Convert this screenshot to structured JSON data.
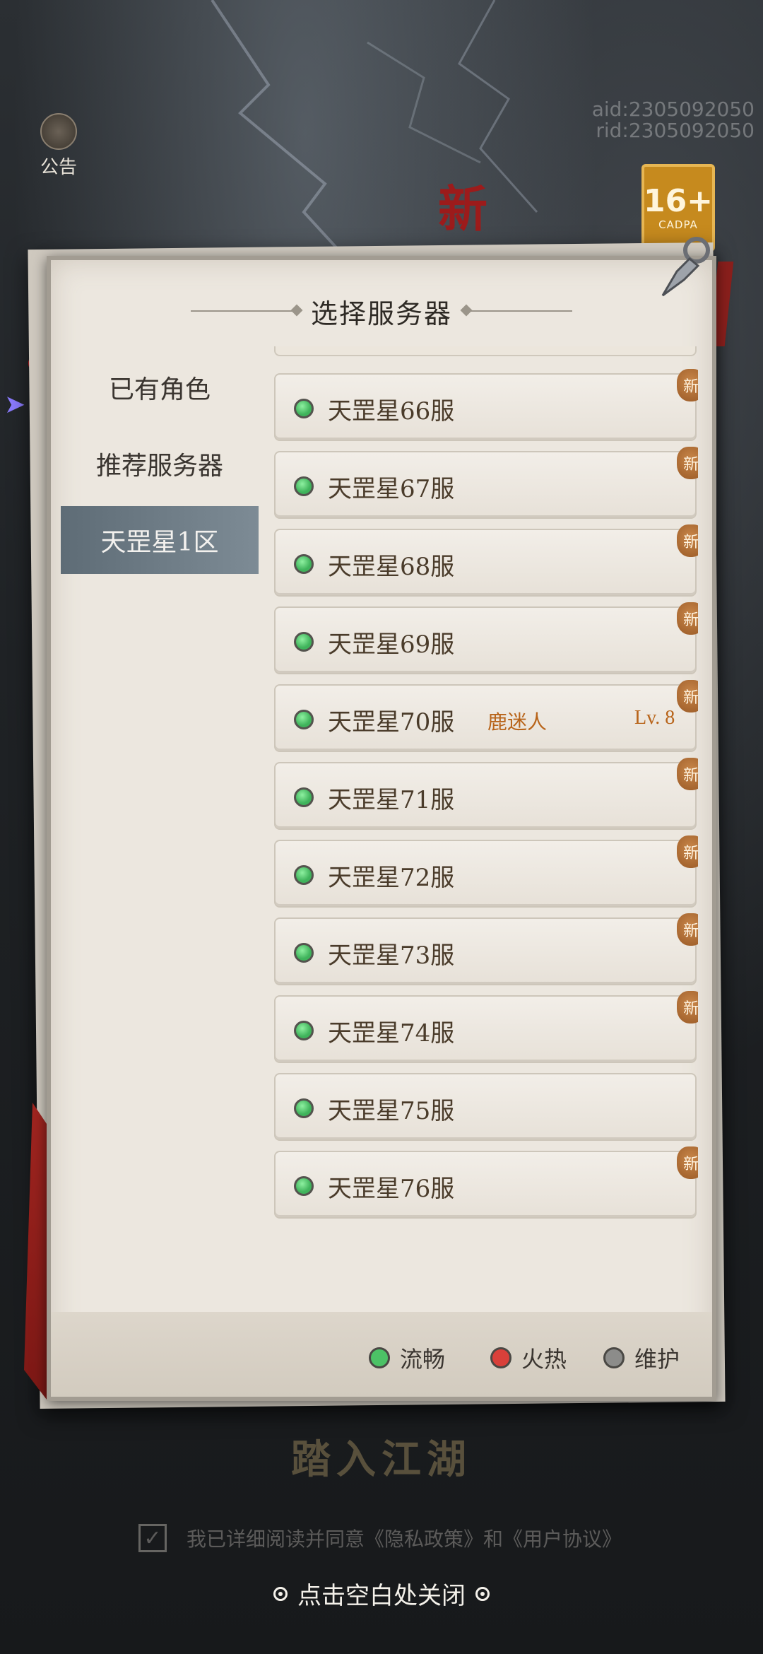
{
  "background": {
    "notice_label": "公告",
    "uid_lines": [
      "aid:2305092050",
      "rid:2305092050"
    ],
    "age_rating": {
      "main": "16+",
      "sub": "CADPA"
    },
    "seal_char": "新"
  },
  "dialog": {
    "title": "选择服务器",
    "sidebar": [
      {
        "label": "已有角色",
        "active": false
      },
      {
        "label": "推荐服务器",
        "active": false
      },
      {
        "label": "天罡星1区",
        "active": true
      }
    ],
    "servers": [
      {
        "name": "天罡星66服",
        "status": "smooth",
        "new": "新",
        "role": "",
        "level": ""
      },
      {
        "name": "天罡星67服",
        "status": "smooth",
        "new": "新",
        "role": "",
        "level": ""
      },
      {
        "name": "天罡星68服",
        "status": "smooth",
        "new": "新",
        "role": "",
        "level": ""
      },
      {
        "name": "天罡星69服",
        "status": "smooth",
        "new": "新",
        "role": "",
        "level": ""
      },
      {
        "name": "天罡星70服",
        "status": "smooth",
        "new": "新",
        "role": "鹿迷人",
        "level": "Lv. 8"
      },
      {
        "name": "天罡星71服",
        "status": "smooth",
        "new": "新",
        "role": "",
        "level": ""
      },
      {
        "name": "天罡星72服",
        "status": "smooth",
        "new": "新",
        "role": "",
        "level": ""
      },
      {
        "name": "天罡星73服",
        "status": "smooth",
        "new": "新",
        "role": "",
        "level": ""
      },
      {
        "name": "天罡星74服",
        "status": "smooth",
        "new": "新",
        "role": "",
        "level": ""
      },
      {
        "name": "天罡星75服",
        "status": "smooth",
        "new": "",
        "role": "",
        "level": ""
      },
      {
        "name": "天罡星76服",
        "status": "smooth",
        "new": "新",
        "role": "",
        "level": ""
      }
    ],
    "legend": [
      {
        "label": "流畅",
        "color": "#4cc266"
      },
      {
        "label": "火热",
        "color": "#d9403a"
      },
      {
        "label": "维护",
        "color": "#8c8c8a"
      }
    ]
  },
  "bottom": {
    "enter_title": "踏入江湖",
    "agree_text": "我已详细阅读并同意《隐私政策》和《用户协议》",
    "close_hint": "点击空白处关闭"
  },
  "colors": {
    "accent_active": "#6f7f8a",
    "role_text": "#b8641a",
    "server_text": "#4a3b2a"
  }
}
